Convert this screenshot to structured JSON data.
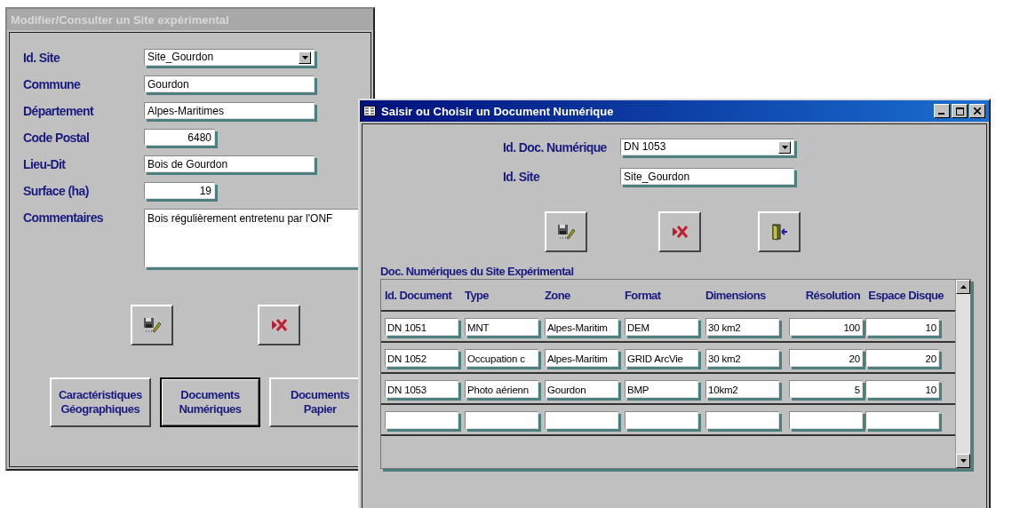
{
  "site_window": {
    "title": "Modifier/Consulter un  Site expérimental",
    "fields": [
      {
        "label": "Id. Site",
        "value": "Site_Gourdon",
        "kind": "combo"
      },
      {
        "label": "Commune",
        "value": "Gourdon",
        "kind": "text"
      },
      {
        "label": "Département",
        "value": "Alpes-Maritimes",
        "kind": "text"
      },
      {
        "label": "Code Postal",
        "value": "6480",
        "kind": "number"
      },
      {
        "label": "Lieu-Dit",
        "value": "Bois de Gourdon",
        "kind": "text"
      },
      {
        "label": "Surface (ha)",
        "value": "19",
        "kind": "number"
      },
      {
        "label": "Commentaires",
        "value": "Bois régulièrement entretenu par l'ONF",
        "kind": "memo"
      }
    ],
    "actions": [
      {
        "kind": "save"
      },
      {
        "kind": "delete"
      }
    ],
    "nav_buttons": [
      {
        "label": "Caractéristiques\nGéographiques",
        "selected": false
      },
      {
        "label": "Documents\nNumériques",
        "selected": true
      },
      {
        "label": "Documents\nPapier",
        "selected": false
      }
    ]
  },
  "document_window": {
    "title": "Saisir ou Choisir un Document Numérique",
    "fields": [
      {
        "label": "Id. Doc. Numérique",
        "value": "DN 1053",
        "kind": "combo"
      },
      {
        "label": "Id. Site",
        "value": "Site_Gourdon",
        "kind": "text"
      }
    ],
    "actions": [
      {
        "kind": "save"
      },
      {
        "kind": "delete"
      },
      {
        "kind": "exit"
      }
    ],
    "subform": {
      "title": "Doc. Numériques du Site Expérimental",
      "columns": [
        {
          "label": "Id. Document",
          "kind": "text"
        },
        {
          "label": "Type",
          "kind": "text"
        },
        {
          "label": "Zone",
          "kind": "text"
        },
        {
          "label": "Format",
          "kind": "text"
        },
        {
          "label": "Dimensions",
          "kind": "text"
        },
        {
          "label": "Résolution",
          "kind": "number"
        },
        {
          "label": "Espace Disque",
          "kind": "number"
        }
      ],
      "rows": [
        [
          "DN 1051",
          "MNT",
          "Alpes-Maritim",
          "DEM",
          "30 km2",
          "100",
          "10"
        ],
        [
          "DN 1052",
          "Occupation c",
          "Alpes-Maritim",
          "GRID ArcVie",
          "30 km2",
          "20",
          "20"
        ],
        [
          "DN 1053",
          "Photo aérienn",
          "Gourdon",
          "BMP",
          "10km2",
          "5",
          "10"
        ]
      ]
    }
  }
}
